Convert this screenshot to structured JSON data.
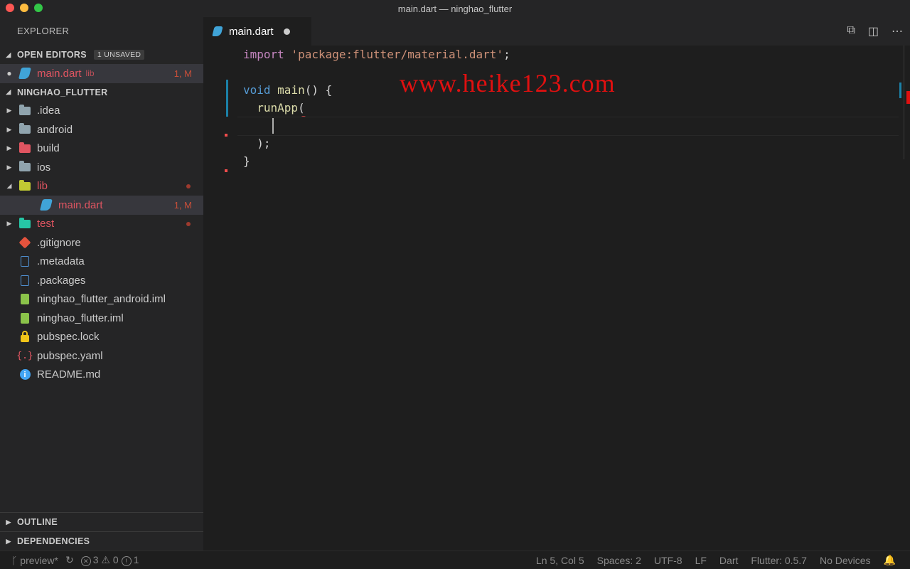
{
  "window": {
    "title": "main.dart — ninghao_flutter"
  },
  "sidebar": {
    "header": "EXPLORER",
    "open_editors": {
      "title": "OPEN EDITORS",
      "badge": "1 UNSAVED",
      "items": [
        {
          "name": "main.dart",
          "path": "lib",
          "status": "1, M"
        }
      ]
    },
    "project": {
      "title": "NINGHAO_FLUTTER",
      "items": [
        {
          "name": ".idea",
          "type": "folder"
        },
        {
          "name": "android",
          "type": "folder"
        },
        {
          "name": "build",
          "type": "folder"
        },
        {
          "name": "ios",
          "type": "folder"
        },
        {
          "name": "lib",
          "type": "folder"
        },
        {
          "name": "main.dart",
          "type": "dart",
          "status": "1, M"
        },
        {
          "name": "test",
          "type": "folder"
        },
        {
          "name": ".gitignore",
          "type": "git"
        },
        {
          "name": ".metadata",
          "type": "file"
        },
        {
          "name": ".packages",
          "type": "file"
        },
        {
          "name": "ninghao_flutter_android.iml",
          "type": "iml"
        },
        {
          "name": "ninghao_flutter.iml",
          "type": "iml"
        },
        {
          "name": "pubspec.lock",
          "type": "lock"
        },
        {
          "name": "pubspec.yaml",
          "type": "yaml"
        },
        {
          "name": "README.md",
          "type": "info"
        }
      ]
    },
    "outline": "OUTLINE",
    "dependencies": "DEPENDENCIES"
  },
  "editor": {
    "tab_label": "main.dart",
    "code": {
      "line1_kw": "import",
      "line1_str": "'package:flutter/material.dart'",
      "line1_end": ";",
      "line3_type": "void",
      "line3_fn": "main",
      "line3_rest": "() {",
      "line4_fn": "runApp",
      "line4_rest": "(",
      "line6": ");",
      "line7": "}"
    },
    "watermark": "www.heike123.com"
  },
  "status_bar": {
    "branch": "preview*",
    "errors": "3",
    "warnings": "0",
    "infos": "1",
    "cursor": "Ln 5, Col 5",
    "spaces": "Spaces: 2",
    "encoding": "UTF-8",
    "eol": "LF",
    "language": "Dart",
    "sdk": "Flutter: 0.5.7",
    "device": "No Devices"
  },
  "colors": {
    "accent": "#1b81a8",
    "error": "#e05561",
    "watermark": "#e01010"
  }
}
